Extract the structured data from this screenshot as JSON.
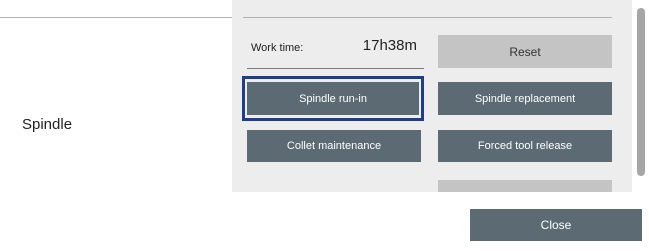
{
  "spindle_section": {
    "label": "Spindle",
    "work_time_label": "Work time:",
    "work_time_value": "17h38m",
    "buttons": {
      "reset": "Reset",
      "spindle_run_in": "Spindle run-in",
      "spindle_replacement": "Spindle replacement",
      "collet_maintenance": "Collet maintenance",
      "forced_tool_release": "Forced tool release",
      "next_partial": ""
    }
  },
  "footer": {
    "close_label": "Close"
  },
  "colors": {
    "button_active": "#5b6a73",
    "button_disabled": "#c4c4c4",
    "focus_ring": "#1f3d8a",
    "panel_background": "#ededed"
  }
}
